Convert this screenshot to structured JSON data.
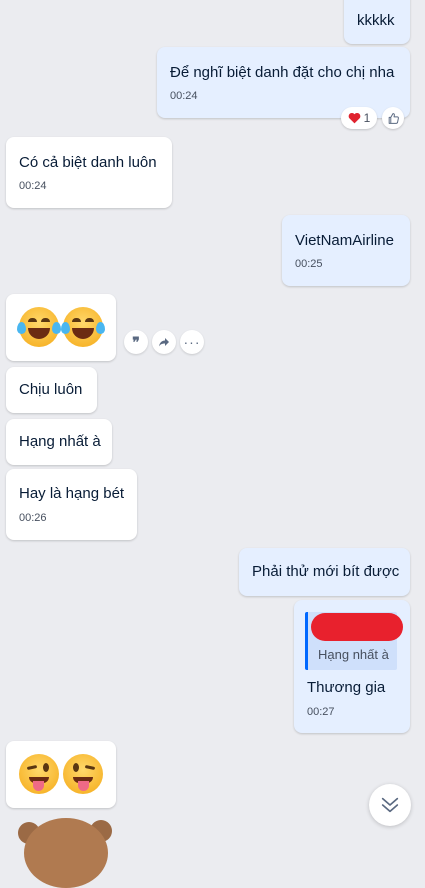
{
  "messages": [
    {
      "id": "m1",
      "text": "kkkkk"
    },
    {
      "id": "m2",
      "text": "Để nghĩ biệt danh đặt cho chị nha",
      "time": "00:24",
      "reaction_count": "1"
    },
    {
      "id": "m3",
      "text": "Có cả biệt danh luôn",
      "time": "00:24"
    },
    {
      "id": "m4",
      "text": "VietNamAirline",
      "time": "00:25"
    },
    {
      "id": "m6",
      "text": "Chịu luôn"
    },
    {
      "id": "m7",
      "text": "Hạng nhất à"
    },
    {
      "id": "m8",
      "text": "Hay là hạng bét",
      "time": "00:26"
    },
    {
      "id": "m9",
      "text": "Phải thử mới bít được"
    },
    {
      "id": "m10",
      "quote": "Hạng nhất à",
      "text": "Thương gia",
      "time": "00:27"
    }
  ],
  "icons": {
    "laugh": "face-with-tears-of-joy-icon",
    "wink": "winking-face-with-tongue-icon",
    "heart": "heart-icon",
    "like": "thumbs-up-icon",
    "quote": "quote-icon",
    "share": "share-icon",
    "more": "more-icon",
    "scroll": "scroll-down-icon"
  },
  "colors": {
    "background": "#ebecf0",
    "incoming": "#ffffff",
    "outgoing": "#e5efff",
    "quote_bar": "#0068ff",
    "redaction": "#e8212d"
  }
}
